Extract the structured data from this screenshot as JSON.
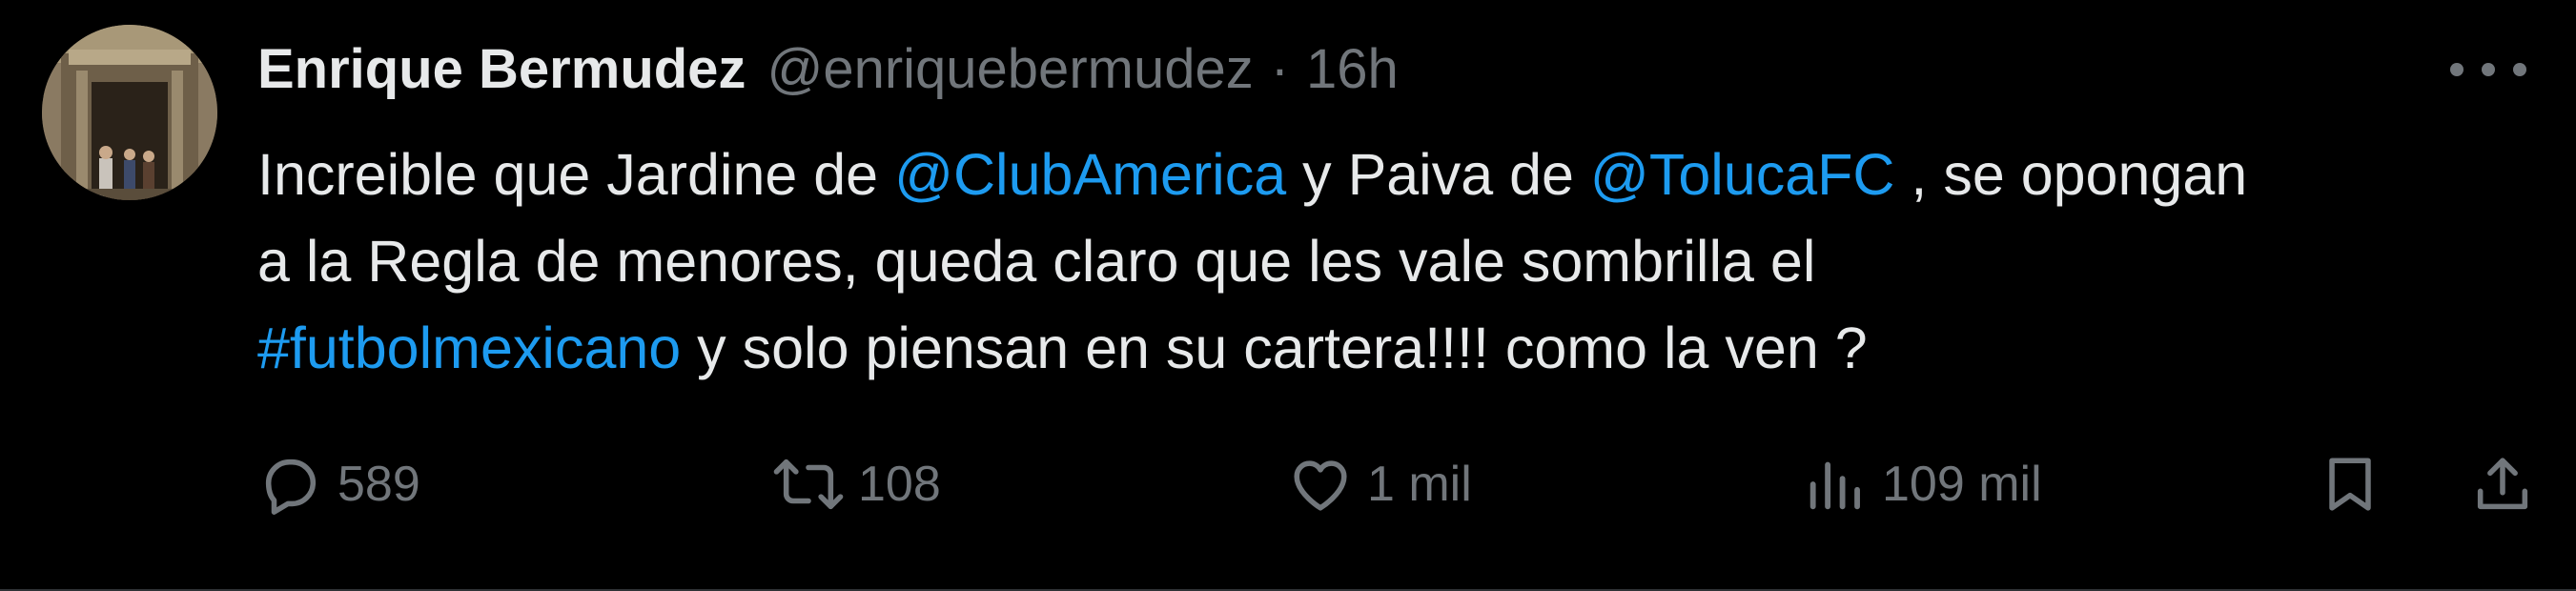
{
  "author": {
    "display_name": "Enrique Bermudez",
    "handle": "@enriquebermudez",
    "separator": "·",
    "time": "16h"
  },
  "tweet": {
    "line1": {
      "t1": "Increible que Jardine de ",
      "mention1": "@ClubAmerica",
      "t2": " y Paiva de ",
      "mention2": "@TolucaFC",
      "t3": " , se opongan"
    },
    "line2": "a la Regla de menores, queda claro que les vale sombrilla el",
    "line3": {
      "hashtag": "#futbolmexicano",
      "t1": " y solo piensan en su cartera!!!! como la ven ?"
    }
  },
  "actions": {
    "replies": "589",
    "retweets": "108",
    "likes": "1 mil",
    "views": "109 mil"
  },
  "colors": {
    "background": "#000000",
    "text": "#e7e9ea",
    "muted": "#71767b",
    "link": "#1d9bf0"
  },
  "icons": [
    "more-icon",
    "reply-icon",
    "retweet-icon",
    "like-icon",
    "views-icon",
    "bookmark-icon",
    "share-icon"
  ]
}
